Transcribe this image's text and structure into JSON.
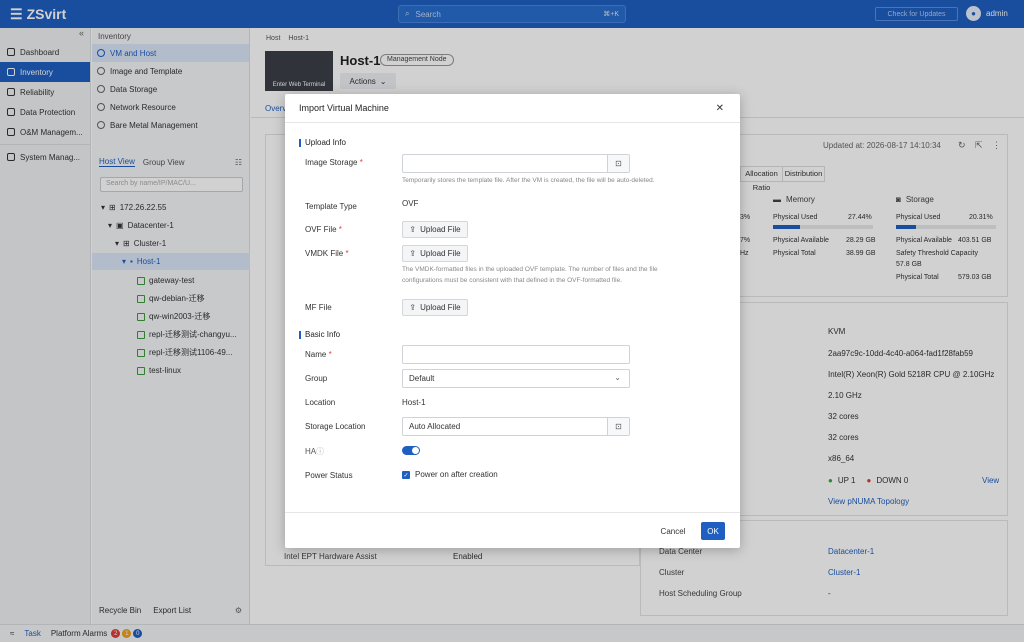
{
  "app": {
    "logo": "ZSvirt"
  },
  "topbar": {
    "search_placeholder": "Search",
    "search_kbd": "⌘+K",
    "check_updates": "Check for Updates",
    "user": "admin"
  },
  "nav": {
    "items": [
      {
        "label": "Dashboard",
        "active": false
      },
      {
        "label": "Inventory",
        "active": true
      },
      {
        "label": "Reliability",
        "active": false
      },
      {
        "label": "Data Protection",
        "active": false
      },
      {
        "label": "O&M Managem...",
        "active": false
      },
      {
        "label": "System Manag...",
        "active": false
      }
    ]
  },
  "inventory": {
    "header": "Inventory",
    "items": [
      "VM and Host",
      "Image and Template",
      "Data Storage",
      "Network Resource",
      "Bare Metal Management"
    ],
    "view_tabs": [
      "Host View",
      "Group View"
    ],
    "search_placeholder": "Search by name/IP/MAC/U...",
    "tree": [
      "172.26.22.55",
      "Datacenter-1",
      "Cluster-1",
      "Host-1",
      "gateway-test",
      "qw-debian-迁移",
      "qw-win2003-迁移",
      "repl-迁移测试-changyu...",
      "repl-迁移测试1106-49...",
      "test-linux"
    ],
    "footer": [
      "Recycle Bin",
      "Export List"
    ]
  },
  "host": {
    "breadcrumb": [
      "Host",
      "Host-1"
    ],
    "terminal": "Enter Web Terminal",
    "title": "Host-1",
    "badge": "Management Node",
    "actions": "Actions",
    "tab": "Overv",
    "updated": "Updated at: 2026-08-17 14:10:34",
    "ratio_tabs": [
      "Allocation Ratio",
      "Distribution"
    ],
    "memory": {
      "title": "Memory",
      "used_label": "Physical Used",
      "used": "27.44%",
      "avail_label": "Physical Available",
      "avail": "28.29 GB",
      "total_label": "Physical Total",
      "total": "38.99 GB"
    },
    "storage": {
      "title": "Storage",
      "used_label": "Physical Used",
      "used": "20.31%",
      "avail_label": "Physical Available",
      "avail": "403.51 GB",
      "safety_label": "Safety Threshold Capacity",
      "safety": "57.8 GB",
      "total_label": "Physical Total",
      "total": "579.03 GB"
    },
    "cpu_partial": {
      "a": "3%",
      "b": "7%",
      "c": "Hz"
    },
    "details": [
      "KVM",
      "2aa97c9c-10dd-4c40-a064-fad1f28fab59",
      "Intel(R) Xeon(R) Gold 5218R CPU @ 2.10GHz",
      "2.10 GHz",
      "32 cores",
      "32 cores",
      "x86_64"
    ],
    "status_up": "UP 1",
    "status_down": "DOWN 0",
    "view": "View",
    "pnuma": "View pNUMA Topology",
    "ept_label": "Intel EPT Hardware Assist",
    "ept_value": "Enabled",
    "dc_label": "Data Center",
    "dc_value": "Datacenter-1",
    "cluster_label": "Cluster",
    "cluster_value": "Cluster-1",
    "sched_label": "Host Scheduling Group",
    "sched_value": "-"
  },
  "bottom": {
    "task": "Task",
    "alarms": "Platform Alarms",
    "counts": [
      "2",
      "1",
      "0"
    ]
  },
  "modal": {
    "title": "Import Virtual Machine",
    "upload_section": "Upload Info",
    "image_storage_label": "Image Storage",
    "image_storage_hint": "Temporarily stores the template file. After the VM is created, the file will be auto-deleted.",
    "template_type_label": "Template Type",
    "template_type_value": "OVF",
    "ovf_label": "OVF File",
    "vmdk_label": "VMDK File",
    "upload_button": "Upload File",
    "vmdk_hint_1": "The VMDK-formatted files in the uploaded OVF template. The number of files and the file",
    "vmdk_hint_2": "configurations must be consistent with that defined in the OVF-formatted file.",
    "mf_label": "MF File",
    "basic_section": "Basic Info",
    "name_label": "Name",
    "group_label": "Group",
    "group_value": "Default",
    "location_label": "Location",
    "location_value": "Host-1",
    "storage_loc_label": "Storage Location",
    "storage_loc_value": "Auto Allocated",
    "ha_label": "HA",
    "power_label": "Power Status",
    "power_value": "Power on after creation",
    "cancel": "Cancel",
    "ok": "OK"
  }
}
